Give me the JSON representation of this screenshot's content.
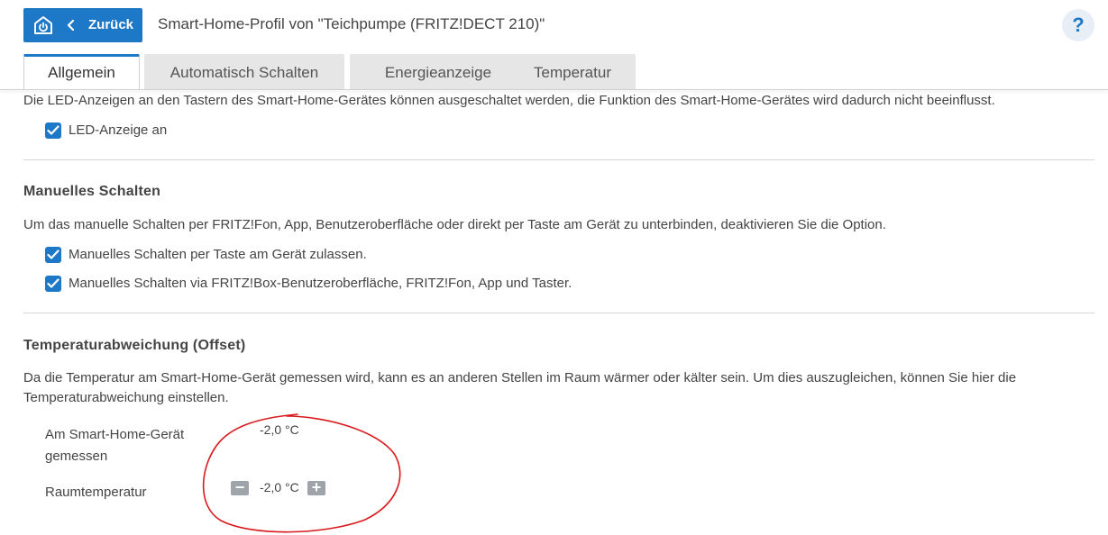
{
  "header": {
    "back_label": "Zurück",
    "title": "Smart-Home-Profil von \"Teichpumpe (FRITZ!DECT 210)\"",
    "help_label": "?"
  },
  "tabs": [
    {
      "label": "Allgemein",
      "active": true
    },
    {
      "label": "Automatisch Schalten",
      "active": false
    },
    {
      "label": "Energieanzeige",
      "active": false
    },
    {
      "label": "Temperatur",
      "active": false
    }
  ],
  "led": {
    "description": "Die LED-Anzeigen an den Tastern des Smart-Home-Gerätes können ausgeschaltet werden, die Funktion des Smart-Home-Gerätes wird dadurch nicht beeinflusst.",
    "checkbox_label": "LED-Anzeige an",
    "checked": true
  },
  "manual": {
    "heading": "Manuelles Schalten",
    "description": "Um das manuelle Schalten per FRITZ!Fon, App, Benutzeroberfläche oder direkt per Taste am Gerät zu unterbinden, deaktivieren Sie die Option.",
    "options": [
      {
        "label": "Manuelles Schalten per Taste am Gerät zulassen.",
        "checked": true
      },
      {
        "label": "Manuelles Schalten via FRITZ!Box-Benutzeroberfläche, FRITZ!Fon, App und Taster.",
        "checked": true
      }
    ]
  },
  "offset": {
    "heading": "Temperaturabweichung (Offset)",
    "description_line1": "Da die Temperatur am Smart-Home-Gerät gemessen wird, kann es an anderen Stellen im Raum wärmer oder kälter sein. Um dies auszugleichen, können Sie hier die",
    "description_line2": "Temperaturabweichung einstellen.",
    "measured_label_line1": "Am Smart-Home-Gerät",
    "measured_label_line2": "gemessen",
    "measured_value": "-2,0 °C",
    "room_label": "Raumtemperatur",
    "room_value": "-2,0 °C",
    "minus": "−",
    "plus": "+"
  },
  "colors": {
    "accent": "#1e78c8",
    "annotation": "#d9191e"
  }
}
